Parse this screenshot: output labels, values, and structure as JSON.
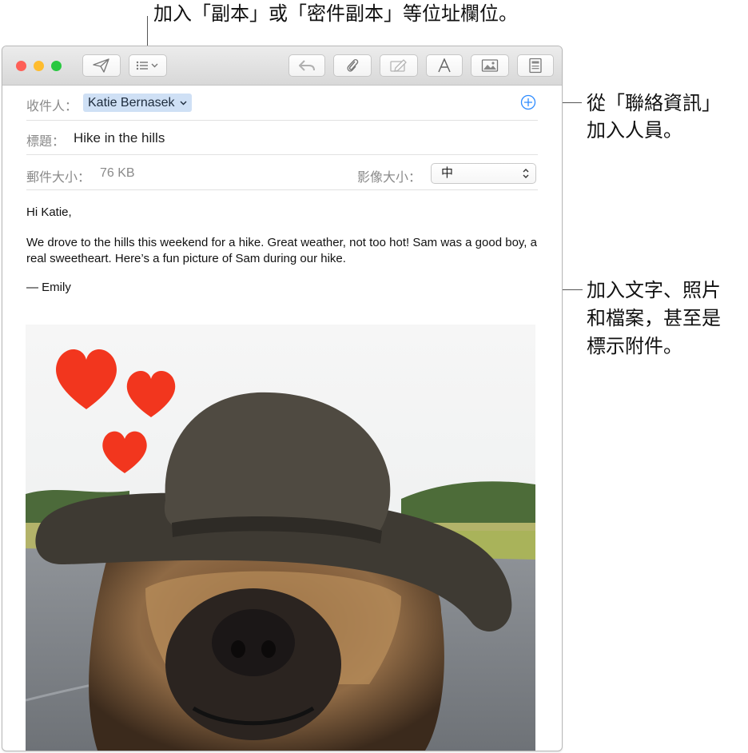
{
  "callouts": {
    "top": "加入「副本」或「密件副本」等位址欄位。",
    "contacts_line1": "從「聯絡資訊」",
    "contacts_line2": "加入人員。",
    "attach_line1": "加入文字、照片",
    "attach_line2": "和檔案，甚至是",
    "attach_line3": "標示附件。"
  },
  "toolbar": {
    "icons": [
      "send-icon",
      "header-fields-icon",
      "reply-icon",
      "attachment-icon",
      "markup-icon",
      "format-icon",
      "photo-browser-icon",
      "stationery-icon"
    ]
  },
  "compose": {
    "to_label": "收件人：",
    "recipient": "Katie Bernasek",
    "subject_label": "標題：",
    "subject": "Hike in the hills",
    "message_size_label": "郵件大小：",
    "message_size": "76 KB",
    "image_size_label": "影像大小：",
    "image_size_value": "中"
  },
  "message": {
    "greeting": "Hi Katie,",
    "paragraph": "We drove to the hills this weekend for a hike. Great weather, not too hot! Sam was a good boy, a real sweetheart. Here’s a fun picture of Sam during our hike.",
    "signature": "— Emily"
  },
  "colors": {
    "close": "#fe5f57",
    "minimize": "#febc2e",
    "zoom": "#28c840",
    "token_bg": "#cfe0f5",
    "add_contact": "#2f8cff",
    "hearts": "#f2361e"
  }
}
